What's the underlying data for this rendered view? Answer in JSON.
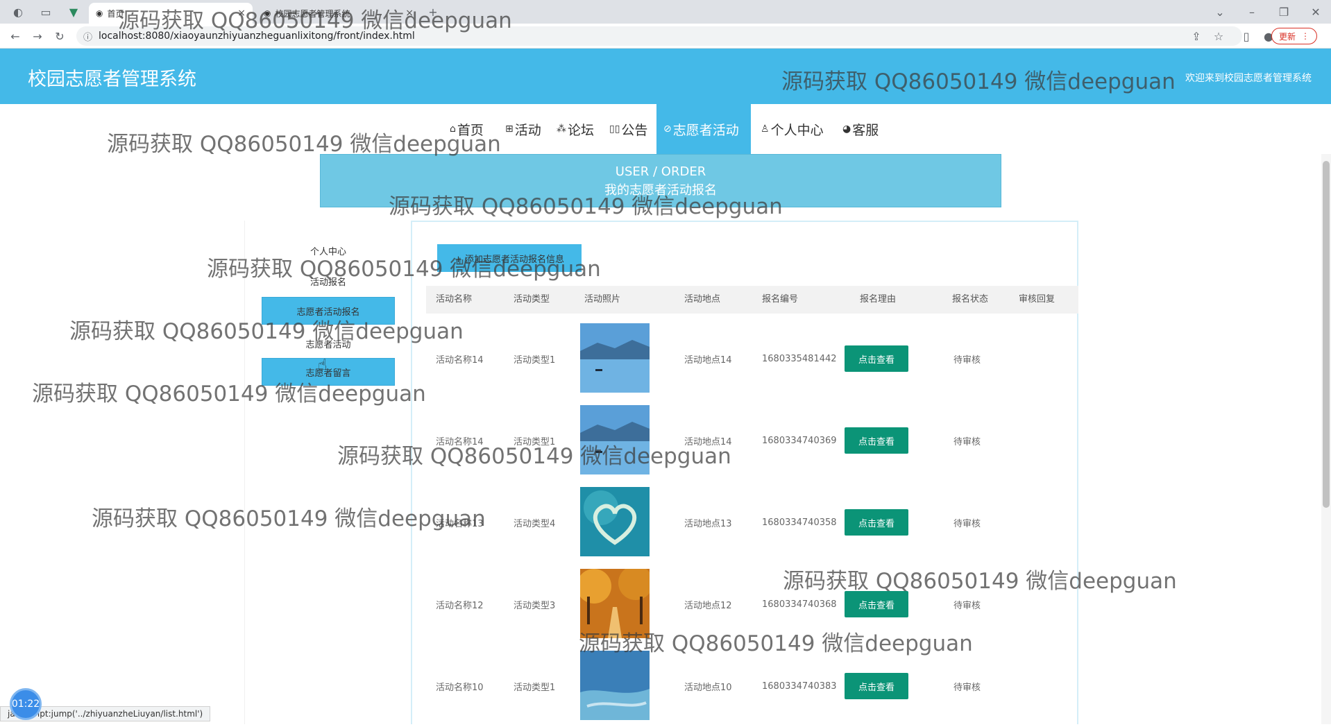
{
  "browser": {
    "tabs": [
      {
        "label": "首页"
      },
      {
        "label": "校园志愿者管理系统"
      }
    ],
    "new_tab": "+",
    "address": "localhost:8080/xiaoyaunzhiyuanzheguanlixitong/front/index.html",
    "update_label": "更新",
    "status_url": "javascript:jump('../zhiyuanzheLiuyan/list.html')"
  },
  "header": {
    "title": "校园志愿者管理系统",
    "welcome": "欢迎来到校园志愿者管理系统"
  },
  "nav": {
    "items": [
      {
        "label": "首页",
        "icon": "home-icon"
      },
      {
        "label": "活动",
        "icon": "grid-icon"
      },
      {
        "label": "论坛",
        "icon": "apps-icon"
      },
      {
        "label": "公告",
        "icon": "columns-icon"
      },
      {
        "label": "志愿者活动",
        "icon": "link-icon",
        "active": true
      },
      {
        "label": "个人中心",
        "icon": "user-icon"
      },
      {
        "label": "客服",
        "icon": "chat-icon"
      }
    ]
  },
  "banner": {
    "en": "USER / ORDER",
    "cn": "我的志愿者活动报名"
  },
  "side": {
    "head1": "个人中心",
    "head2": "活动报名",
    "btn1": "志愿者活动报名",
    "head3": "志愿者活动",
    "btn2": "志愿者留言"
  },
  "main": {
    "add_button": "+ 添加志愿者活动报名信息",
    "columns": [
      "活动名称",
      "活动类型",
      "活动照片",
      "活动地点",
      "报名编号",
      "报名理由",
      "报名状态",
      "审核回复"
    ],
    "view_label": "点击查看",
    "rows": [
      {
        "name": "活动名称14",
        "type": "活动类型1",
        "photo": "lake",
        "place": "活动地点14",
        "code": "1680335481442",
        "status": "待审核"
      },
      {
        "name": "活动名称14",
        "type": "活动类型1",
        "photo": "lake",
        "place": "活动地点14",
        "code": "1680334740369",
        "status": "待审核"
      },
      {
        "name": "活动名称13",
        "type": "活动类型4",
        "photo": "heart-island",
        "place": "活动地点13",
        "code": "1680334740358",
        "status": "待审核"
      },
      {
        "name": "活动名称12",
        "type": "活动类型3",
        "photo": "autumn-road",
        "place": "活动地点12",
        "code": "1680334740368",
        "status": "待审核"
      },
      {
        "name": "活动名称10",
        "type": "活动类型1",
        "photo": "river",
        "place": "活动地点10",
        "code": "1680334740383",
        "status": "待审核"
      }
    ]
  },
  "watermark": "源码获取 QQ86050149 微信deepguan",
  "timer": "01:22"
}
